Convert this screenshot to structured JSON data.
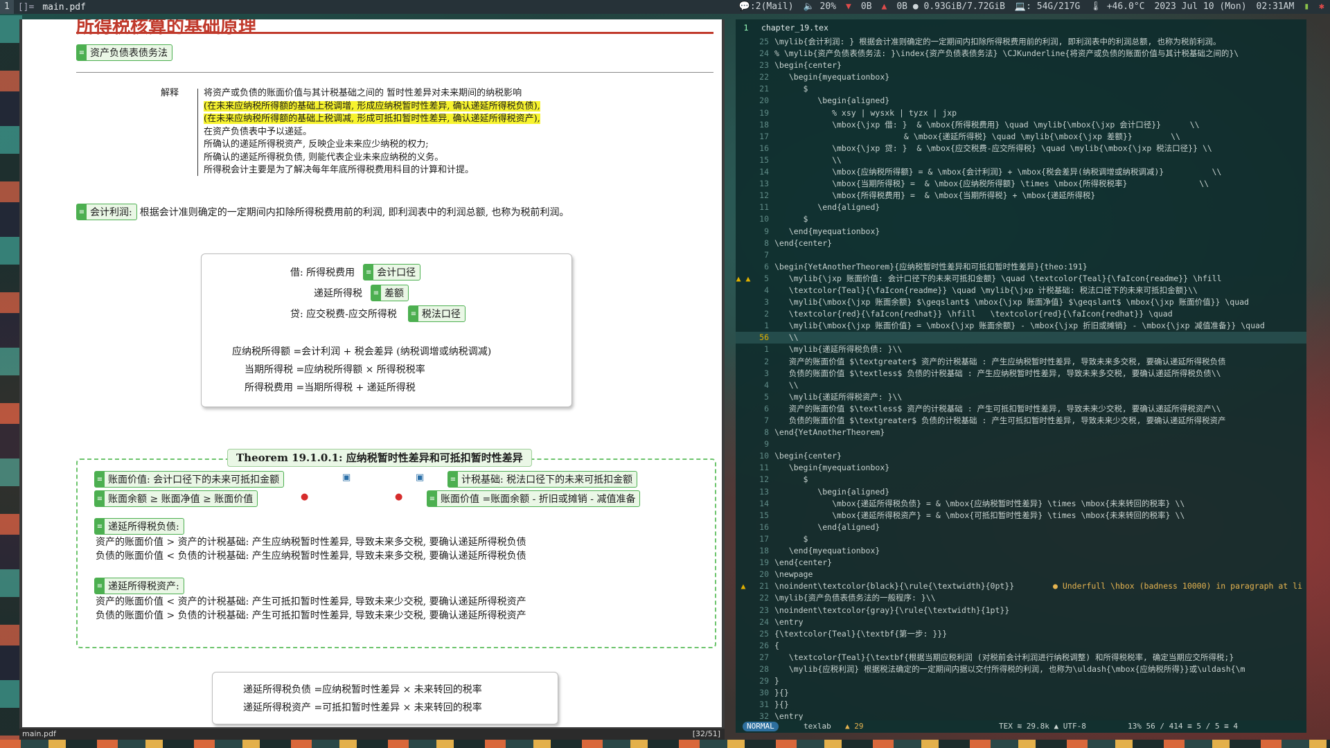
{
  "topbar": {
    "workspace": "1",
    "layout": "[]=",
    "title": "main.pdf",
    "items": [
      "💬:2(Mail)",
      "🔈 20%",
      "0B",
      "0B ● 0.93GiB/7.72GiB",
      "💻: 54G/217G",
      "🌡 +46.0°C",
      "2023 Jul 10 (Mon)",
      "02:31AM"
    ]
  },
  "pdf": {
    "heading": "所得税核算的基础原理",
    "section_tag": "资产负债表债务法",
    "explanation": {
      "label": "解释",
      "lines": [
        {
          "text": "将资产或负债的账面价值与其计税基础之间的 暂时性差异对未来期间的纳税影响",
          "hl": false
        },
        {
          "text": "(在未来应纳税所得额的基础上税调增, 形成应纳税暂时性差异, 确认递延所得税负债),",
          "hl": true
        },
        {
          "text": "(在未来应纳税所得额的基础上税调减, 形成可抵扣暂时性差异, 确认递延所得税资产),",
          "hl": true
        },
        {
          "text": "在资产负债表中予以递延。",
          "hl": false
        },
        {
          "text": "所确认的递延所得税资产, 反映企业未来应少纳税的权力;",
          "hl": false
        },
        {
          "text": "所确认的递延所得税负债, 则能代表企业未来应纳税的义务。",
          "hl": false
        },
        {
          "text": "所得税会计主要是为了解决每年年底所得税费用科目的计算和计提。",
          "hl": false
        }
      ]
    },
    "accounting_profit": {
      "tag": "会计利润:",
      "desc": "根据会计准则确定的一定期间内扣除所得税费用前的利润, 即利润表中的利润总额, 也称为税前利润。"
    },
    "journal": {
      "debit": "借: 所得税费用",
      "debit_tag": "会计口径",
      "deferred": "递延所得税",
      "deferred_tag": "差额",
      "credit": "贷: 应交税费-应交所得税",
      "credit_tag": "税法口径",
      "eq1": "应纳税所得额 =会计利润 + 税会差异 (纳税调增或纳税调减)",
      "eq2": "当期所得税 =应纳税所得额 × 所得税税率",
      "eq3": "所得税费用 =当期所得税 + 递延所得税"
    },
    "theorem": {
      "title": "Theorem 19.1.0.1: 应纳税暂时性差异和可抵扣暂时性差异",
      "left_tag1": "账面价值: 会计口径下的未来可抵扣金额",
      "left_tag2": "账面余额 ≥ 账面净值 ≥ 账面价值",
      "right_tag1": "计税基础: 税法口径下的未来可抵扣金额",
      "right_tag2": "账面价值 =账面余额 - 折旧或摊销 - 减值准备",
      "dtl_tag": "递延所得税负债:",
      "dtl_lines": [
        "资产的账面价值 > 资产的计税基础: 产生应纳税暂时性差异, 导致未来多交税, 要确认递延所得税负债",
        "负债的账面价值 < 负债的计税基础: 产生应纳税暂时性差异, 导致未来多交税, 要确认递延所得税负债"
      ],
      "dta_tag": "递延所得税资产:",
      "dta_lines": [
        "资产的账面价值 < 资产的计税基础: 产生可抵扣暂时性差异, 导致未来少交税, 要确认递延所得税资产",
        "负债的账面价值 > 负债的计税基础: 产生可抵扣暂时性差异, 导致未来少交税, 要确认递延所得税资产"
      ]
    },
    "bottom": {
      "eq1": "递延所得税负债 =应纳税暂时性差异 × 未来转回的税率",
      "eq2": "递延所得税资产 =可抵扣暂时性差异 × 未来转回的税率"
    },
    "status_left": "main.pdf",
    "status_right": "[32/51]"
  },
  "editor": {
    "tab_num": "1",
    "tab_name": "chapter_19.tex",
    "lines": [
      {
        "g": "",
        "n": "25",
        "c": "\\mylib{会计利润: } 根据会计准则确定的一定期间内扣除所得税费用前的利润, 即利润表中的利润总额, 也称为税前利润。"
      },
      {
        "g": "",
        "n": "24",
        "c": "% \\mylib{资产负债表债务法: }\\index{资产负债表债务法} \\CJKunderline{将资产或负债的账面价值与其计税基础之间的}\\"
      },
      {
        "g": "",
        "n": "23",
        "c": "\\begin{center}"
      },
      {
        "g": "",
        "n": "22",
        "c": "   \\begin{myequationbox}"
      },
      {
        "g": "",
        "n": "21",
        "c": "      $"
      },
      {
        "g": "",
        "n": "20",
        "c": "         \\begin{aligned}"
      },
      {
        "g": "",
        "n": "19",
        "c": "            % xsy | wysxk | tyzx | jxp"
      },
      {
        "g": "",
        "n": "18",
        "c": "            \\mbox{\\jxp 借: }  & \\mbox{所得税费用} \\quad \\mylib{\\mbox{\\jxp 会计口径}}      \\\\"
      },
      {
        "g": "",
        "n": "17",
        "c": "                           & \\mbox{递延所得税} \\quad \\mylib{\\mbox{\\jxp 差额}}        \\\\"
      },
      {
        "g": "",
        "n": "16",
        "c": "            \\mbox{\\jxp 贷: }  & \\mbox{应交税费-应交所得税} \\quad \\mylib{\\mbox{\\jxp 税法口径}} \\\\"
      },
      {
        "g": "",
        "n": "15",
        "c": "            \\\\"
      },
      {
        "g": "",
        "n": "14",
        "c": "            \\mbox{应纳税所得额} = & \\mbox{会计利润} + \\mbox{税会差异(纳税调增或纳税调减)}          \\\\"
      },
      {
        "g": "",
        "n": "13",
        "c": "            \\mbox{当期所得税} =  & \\mbox{应纳税所得额} \\times \\mbox{所得税税率}               \\\\"
      },
      {
        "g": "",
        "n": "12",
        "c": "            \\mbox{所得税费用} =  & \\mbox{当期所得税} + \\mbox{递延所得税}"
      },
      {
        "g": "",
        "n": "11",
        "c": "         \\end{aligned}"
      },
      {
        "g": "",
        "n": "10",
        "c": "      $"
      },
      {
        "g": "",
        "n": "9",
        "c": "   \\end{myequationbox}"
      },
      {
        "g": "",
        "n": "8",
        "c": "\\end{center}"
      },
      {
        "g": "",
        "n": "7",
        "c": ""
      },
      {
        "g": "",
        "n": "6",
        "c": "\\begin{YetAnotherTheorem}{应纳税暂时性差异和可抵扣暂时性差异}{theo:191}"
      },
      {
        "g": "▲ ▲",
        "n": "5",
        "c": "   \\mylib{\\jxp 账面价值: 会计口径下的未来可抵扣金额} \\quad \\textcolor{Teal}{\\faIcon{readme}} \\hfill"
      },
      {
        "g": "",
        "n": "4",
        "c": "   \\textcolor{Teal}{\\faIcon{readme}} \\quad \\mylib{\\jxp 计税基础: 税法口径下的未来可抵扣金额}\\\\"
      },
      {
        "g": "",
        "n": "3",
        "c": "   \\mylib{\\mbox{\\jxp 账面余额} $\\geqslant$ \\mbox{\\jxp 账面净值} $\\geqslant$ \\mbox{\\jxp 账面价值}} \\quad"
      },
      {
        "g": "",
        "n": "2",
        "c": "   \\textcolor{red}{\\faIcon{redhat}} \\hfill   \\textcolor{red}{\\faIcon{redhat}} \\quad"
      },
      {
        "g": "",
        "n": "1",
        "c": "   \\mylib{\\mbox{\\jxp 账面价值} = \\mbox{\\jxp 账面余额} - \\mbox{\\jxp 折旧或摊销} - \\mbox{\\jxp 减值准备}} \\quad"
      },
      {
        "g": "",
        "n": "56",
        "c": "   \\\\",
        "cur": true
      },
      {
        "g": "",
        "n": "1",
        "c": "   \\mylib{递延所得税负债: }\\\\"
      },
      {
        "g": "",
        "n": "2",
        "c": "   资产的账面价值 $\\textgreater$ 资产的计税基础 : 产生应纳税暂时性差异, 导致未来多交税, 要确认递延所得税负债"
      },
      {
        "g": "",
        "n": "3",
        "c": "   负债的账面价值 $\\textless$ 负债的计税基础 : 产生应纳税暂时性差异, 导致未来多交税, 要确认递延所得税负债\\\\"
      },
      {
        "g": "",
        "n": "4",
        "c": "   \\\\"
      },
      {
        "g": "",
        "n": "5",
        "c": "   \\mylib{递延所得税资产: }\\\\"
      },
      {
        "g": "",
        "n": "6",
        "c": "   资产的账面价值 $\\textless$ 资产的计税基础 : 产生可抵扣暂时性差异, 导致未来少交税, 要确认递延所得税资产\\\\"
      },
      {
        "g": "",
        "n": "7",
        "c": "   负债的账面价值 $\\textgreater$ 负债的计税基础 : 产生可抵扣暂时性差异, 导致未来少交税, 要确认递延所得税资产"
      },
      {
        "g": "",
        "n": "8",
        "c": "\\end{YetAnotherTheorem}"
      },
      {
        "g": "",
        "n": "9",
        "c": ""
      },
      {
        "g": "",
        "n": "10",
        "c": "\\begin{center}"
      },
      {
        "g": "",
        "n": "11",
        "c": "   \\begin{myequationbox}"
      },
      {
        "g": "",
        "n": "12",
        "c": "      $"
      },
      {
        "g": "",
        "n": "13",
        "c": "         \\begin{aligned}"
      },
      {
        "g": "",
        "n": "14",
        "c": "            \\mbox{递延所得税负债} = & \\mbox{应纳税暂时性差异} \\times \\mbox{未来转回的税率} \\\\"
      },
      {
        "g": "",
        "n": "15",
        "c": "            \\mbox{递延所得税资产} = & \\mbox{可抵扣暂时性差异} \\times \\mbox{未来转回的税率} \\\\"
      },
      {
        "g": "",
        "n": "16",
        "c": "         \\end{aligned}"
      },
      {
        "g": "",
        "n": "17",
        "c": "      $"
      },
      {
        "g": "",
        "n": "18",
        "c": "   \\end{myequationbox}"
      },
      {
        "g": "",
        "n": "19",
        "c": "\\end{center}"
      },
      {
        "g": "",
        "n": "20",
        "c": "\\newpage"
      },
      {
        "g": "▲",
        "n": "21",
        "c": "\\noindent\\textcolor{black}{\\rule{\\textwidth}{0pt}}",
        "diag": "● Underfull \\hbox (badness 10000) in paragraph at li"
      },
      {
        "g": "",
        "n": "22",
        "c": "\\mylib{资产负债表债务法的一般程序: }\\\\"
      },
      {
        "g": "",
        "n": "23",
        "c": "\\noindent\\textcolor{gray}{\\rule{\\textwidth}{1pt}}"
      },
      {
        "g": "",
        "n": "24",
        "c": "\\entry"
      },
      {
        "g": "",
        "n": "25",
        "c": "{\\textcolor{Teal}{\\textbf{第一步: }}}"
      },
      {
        "g": "",
        "n": "26",
        "c": "{"
      },
      {
        "g": "",
        "n": "27",
        "c": "   \\textcolor{Teal}{\\textbf{根据当期应税利润 (对税前会计利润进行纳税调整) 和所得税税率, 确定当期应交所得税;}"
      },
      {
        "g": "",
        "n": "28",
        "c": "   \\mylib{应税利润} 根据税法确定的一定期间内据以交付所得税的利润, 也称为\\uldash{\\mbox{应纳税所得}}或\\uldash{\\m"
      },
      {
        "g": "",
        "n": "29",
        "c": "}"
      },
      {
        "g": "",
        "n": "30",
        "c": "}{}"
      },
      {
        "g": "",
        "n": "31",
        "c": "}{}"
      },
      {
        "g": "",
        "n": "32",
        "c": "\\entry"
      }
    ],
    "status": {
      "mode": "NORMAL",
      "lsp": "texlab",
      "lsp_warn": "▲ 29",
      "filetype": "TEX ≋ 29.8k ▲ UTF-8",
      "position": "13%  56 / 414 ≡  5 /  5 ≡ 4"
    }
  }
}
